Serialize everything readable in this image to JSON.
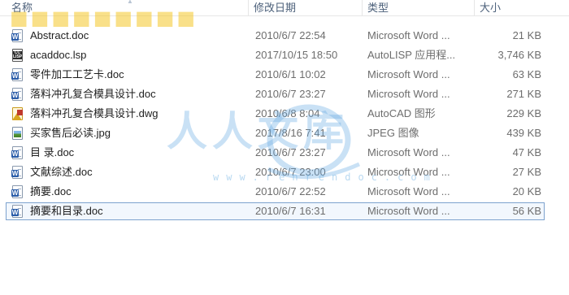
{
  "columns": {
    "name": "名称",
    "date": "修改日期",
    "type": "类型",
    "size": "大小"
  },
  "files": [
    {
      "name": "Abstract.doc",
      "date": "2010/6/7 22:54",
      "type": "Microsoft Word ...",
      "size": "21 KB",
      "icon": "word-doc-icon"
    },
    {
      "name": "acaddoc.lsp",
      "date": "2017/10/15 18:50",
      "type": "AutoLISP 应用程...",
      "size": "3,746 KB",
      "icon": "autolisp-icon"
    },
    {
      "name": "零件加工工艺卡.doc",
      "date": "2010/6/1 10:02",
      "type": "Microsoft Word ...",
      "size": "63 KB",
      "icon": "word-doc-icon"
    },
    {
      "name": "落料冲孔复合模具设计.doc",
      "date": "2010/6/7 23:27",
      "type": "Microsoft Word ...",
      "size": "271 KB",
      "icon": "word-doc-icon"
    },
    {
      "name": "落料冲孔复合模具设计.dwg",
      "date": "2010/6/8 8:04",
      "type": "AutoCAD 图形",
      "size": "229 KB",
      "icon": "autocad-dwg-icon"
    },
    {
      "name": "买家售后必读.jpg",
      "date": "2017/8/16 7:41",
      "type": "JPEG 图像",
      "size": "439 KB",
      "icon": "jpeg-image-icon"
    },
    {
      "name": "目 录.doc",
      "date": "2010/6/7 23:27",
      "type": "Microsoft Word ...",
      "size": "47 KB",
      "icon": "word-doc-icon"
    },
    {
      "name": "文献综述.doc",
      "date": "2010/6/7 23:00",
      "type": "Microsoft Word ...",
      "size": "27 KB",
      "icon": "word-doc-icon"
    },
    {
      "name": "摘要.doc",
      "date": "2010/6/7 22:52",
      "type": "Microsoft Word ...",
      "size": "20 KB",
      "icon": "word-doc-icon"
    },
    {
      "name": "摘要和目录.doc",
      "date": "2010/6/7 16:31",
      "type": "Microsoft Word ...",
      "size": "56 KB",
      "icon": "word-doc-icon",
      "selected": true
    }
  ],
  "watermarks": {
    "logo_text": "人人文库",
    "url": "www.renrendoc.com"
  },
  "colors": {
    "header_text": "#4c607a",
    "selection_border": "#7da2ce",
    "selection_fill": "#f2f7fd",
    "watermark_blue": "#64aae1",
    "watermark_yellow": "#f4c628"
  }
}
